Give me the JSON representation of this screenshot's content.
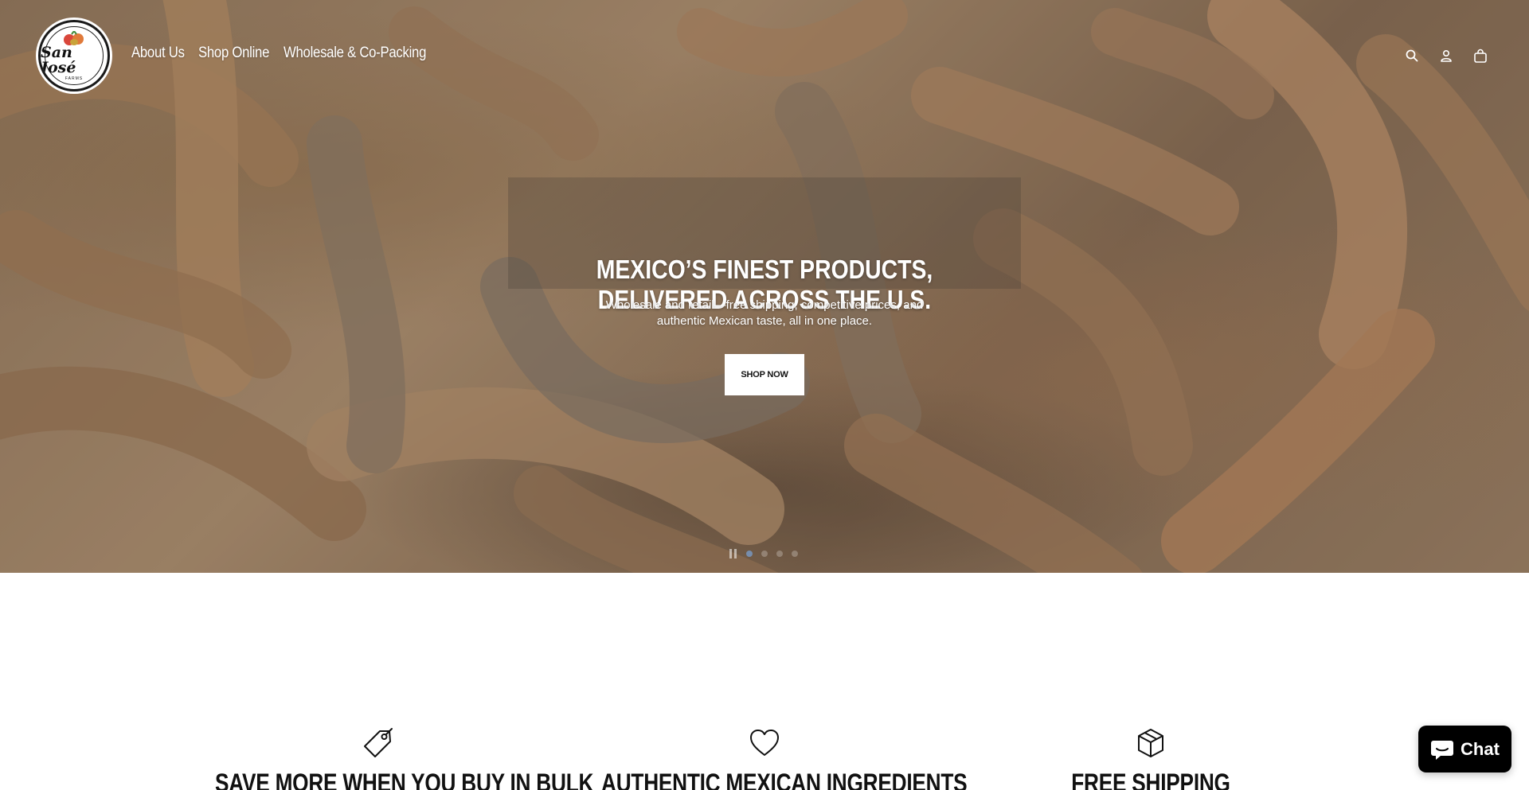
{
  "brand": {
    "logo_text": "San José",
    "logo_subtext": "FARMS"
  },
  "nav": {
    "items": [
      {
        "label": "About Us"
      },
      {
        "label": "Shop Online"
      },
      {
        "label": "Wholesale & Co-Packing"
      }
    ]
  },
  "header_icons": [
    "search-icon",
    "account-icon",
    "cart-icon"
  ],
  "hero": {
    "headline": "MEXICO’S FINEST PRODUCTS, DELIVERED ACROSS THE U.S.",
    "subtext": "Wholesale and retail—free shipping, competitive prices, and authentic Mexican taste, all in one place.",
    "cta_label": "SHOP NOW",
    "slides_count": 4,
    "active_slide": 1
  },
  "features": [
    {
      "icon": "price-tag-icon",
      "title": "SAVE MORE WHEN YOU BUY IN BULK"
    },
    {
      "icon": "heart-icon",
      "title": "AUTHENTIC MEXICAN INGREDIENTS"
    },
    {
      "icon": "box-icon",
      "title": "FREE SHIPPING"
    }
  ],
  "chat": {
    "label": "Chat"
  },
  "colors": {
    "hero_tone": "#a2856a",
    "button_bg": "#ffffff",
    "chat_bg": "#000000",
    "active_dot": "#7896be"
  }
}
